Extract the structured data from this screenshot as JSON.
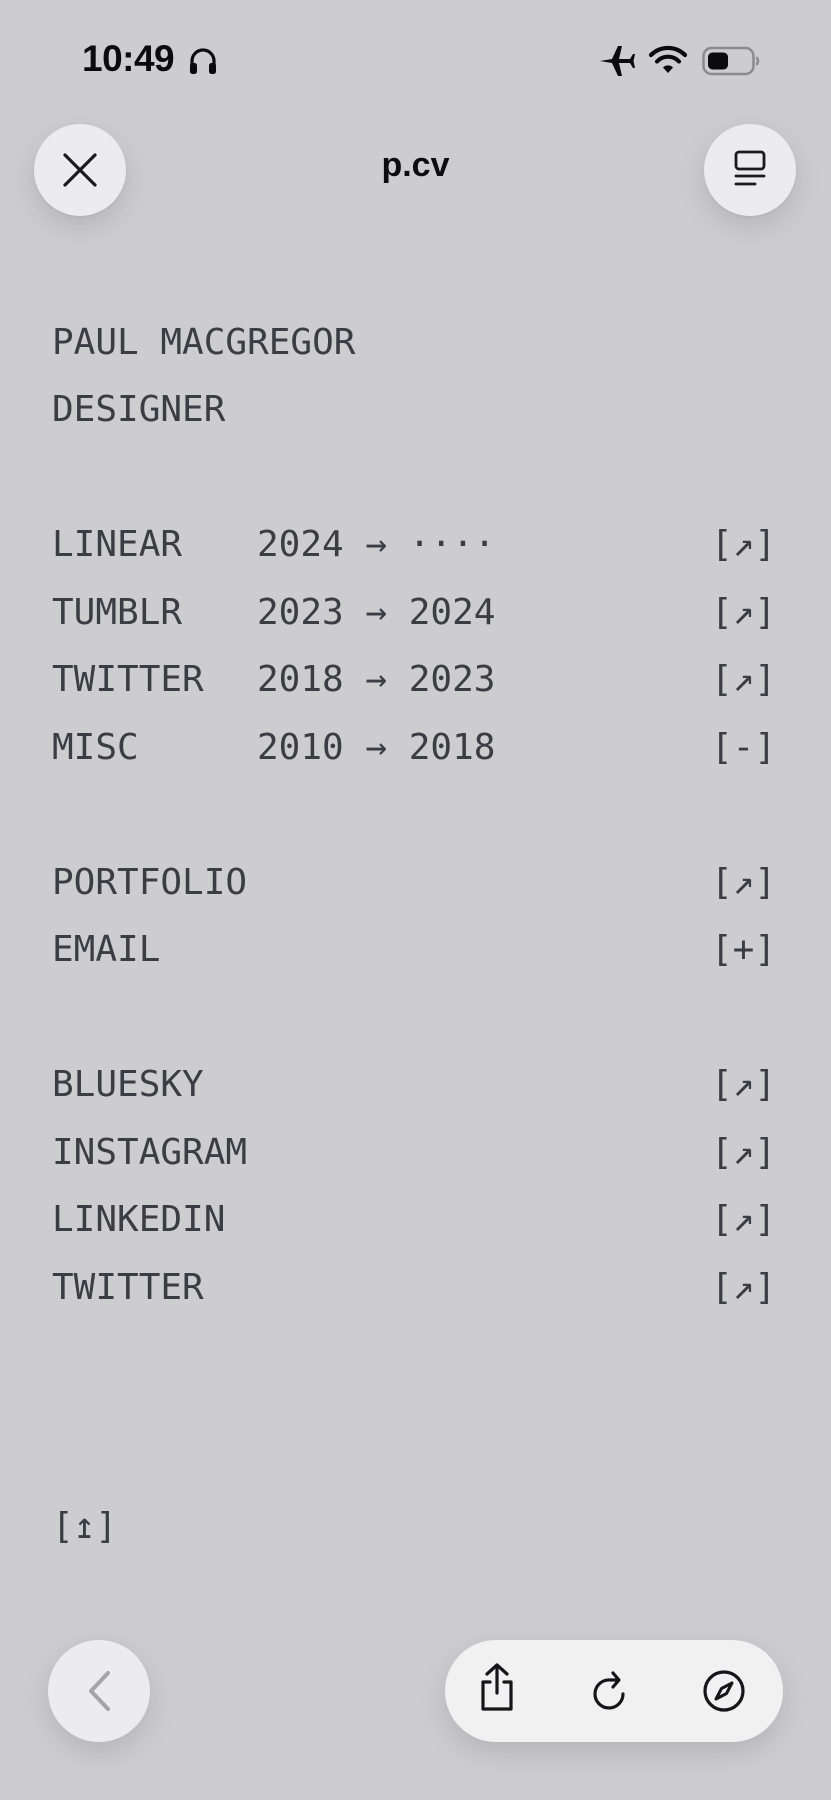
{
  "status_bar": {
    "time": "10:49",
    "icons": [
      "headphones-icon",
      "airplane-icon",
      "wifi-icon",
      "battery-icon"
    ]
  },
  "nav": {
    "title": "p.cv",
    "close_icon": "close-icon",
    "reader_icon": "reader-icon"
  },
  "header": {
    "name": "PAUL MACGREGOR",
    "role": "DESIGNER"
  },
  "experience": [
    {
      "company": "LINEAR",
      "years": "2024 → ····",
      "action": "[↗]"
    },
    {
      "company": "TUMBLR",
      "years": "2023 → 2024",
      "action": "[↗]"
    },
    {
      "company": "TWITTER",
      "years": "2018 → 2023",
      "action": "[↗]"
    },
    {
      "company": "MISC",
      "years": "2010 → 2018",
      "action": "[-]"
    }
  ],
  "links": [
    {
      "label": "PORTFOLIO",
      "action": "[↗]"
    },
    {
      "label": "EMAIL",
      "action": "[+]"
    }
  ],
  "social": [
    {
      "label": "BLUESKY",
      "action": "[↗]"
    },
    {
      "label": "INSTAGRAM",
      "action": "[↗]"
    },
    {
      "label": "LINKEDIN",
      "action": "[↗]"
    },
    {
      "label": "TWITTER",
      "action": "[↗]"
    }
  ],
  "footer": {
    "to_top": "[↥]"
  },
  "bottom_bar": {
    "icons": [
      "back-icon",
      "share-icon",
      "reload-icon",
      "compass-icon"
    ]
  },
  "colors": {
    "background": "#cdcdd0",
    "text": "#3c3c44",
    "button": "#ececee"
  }
}
